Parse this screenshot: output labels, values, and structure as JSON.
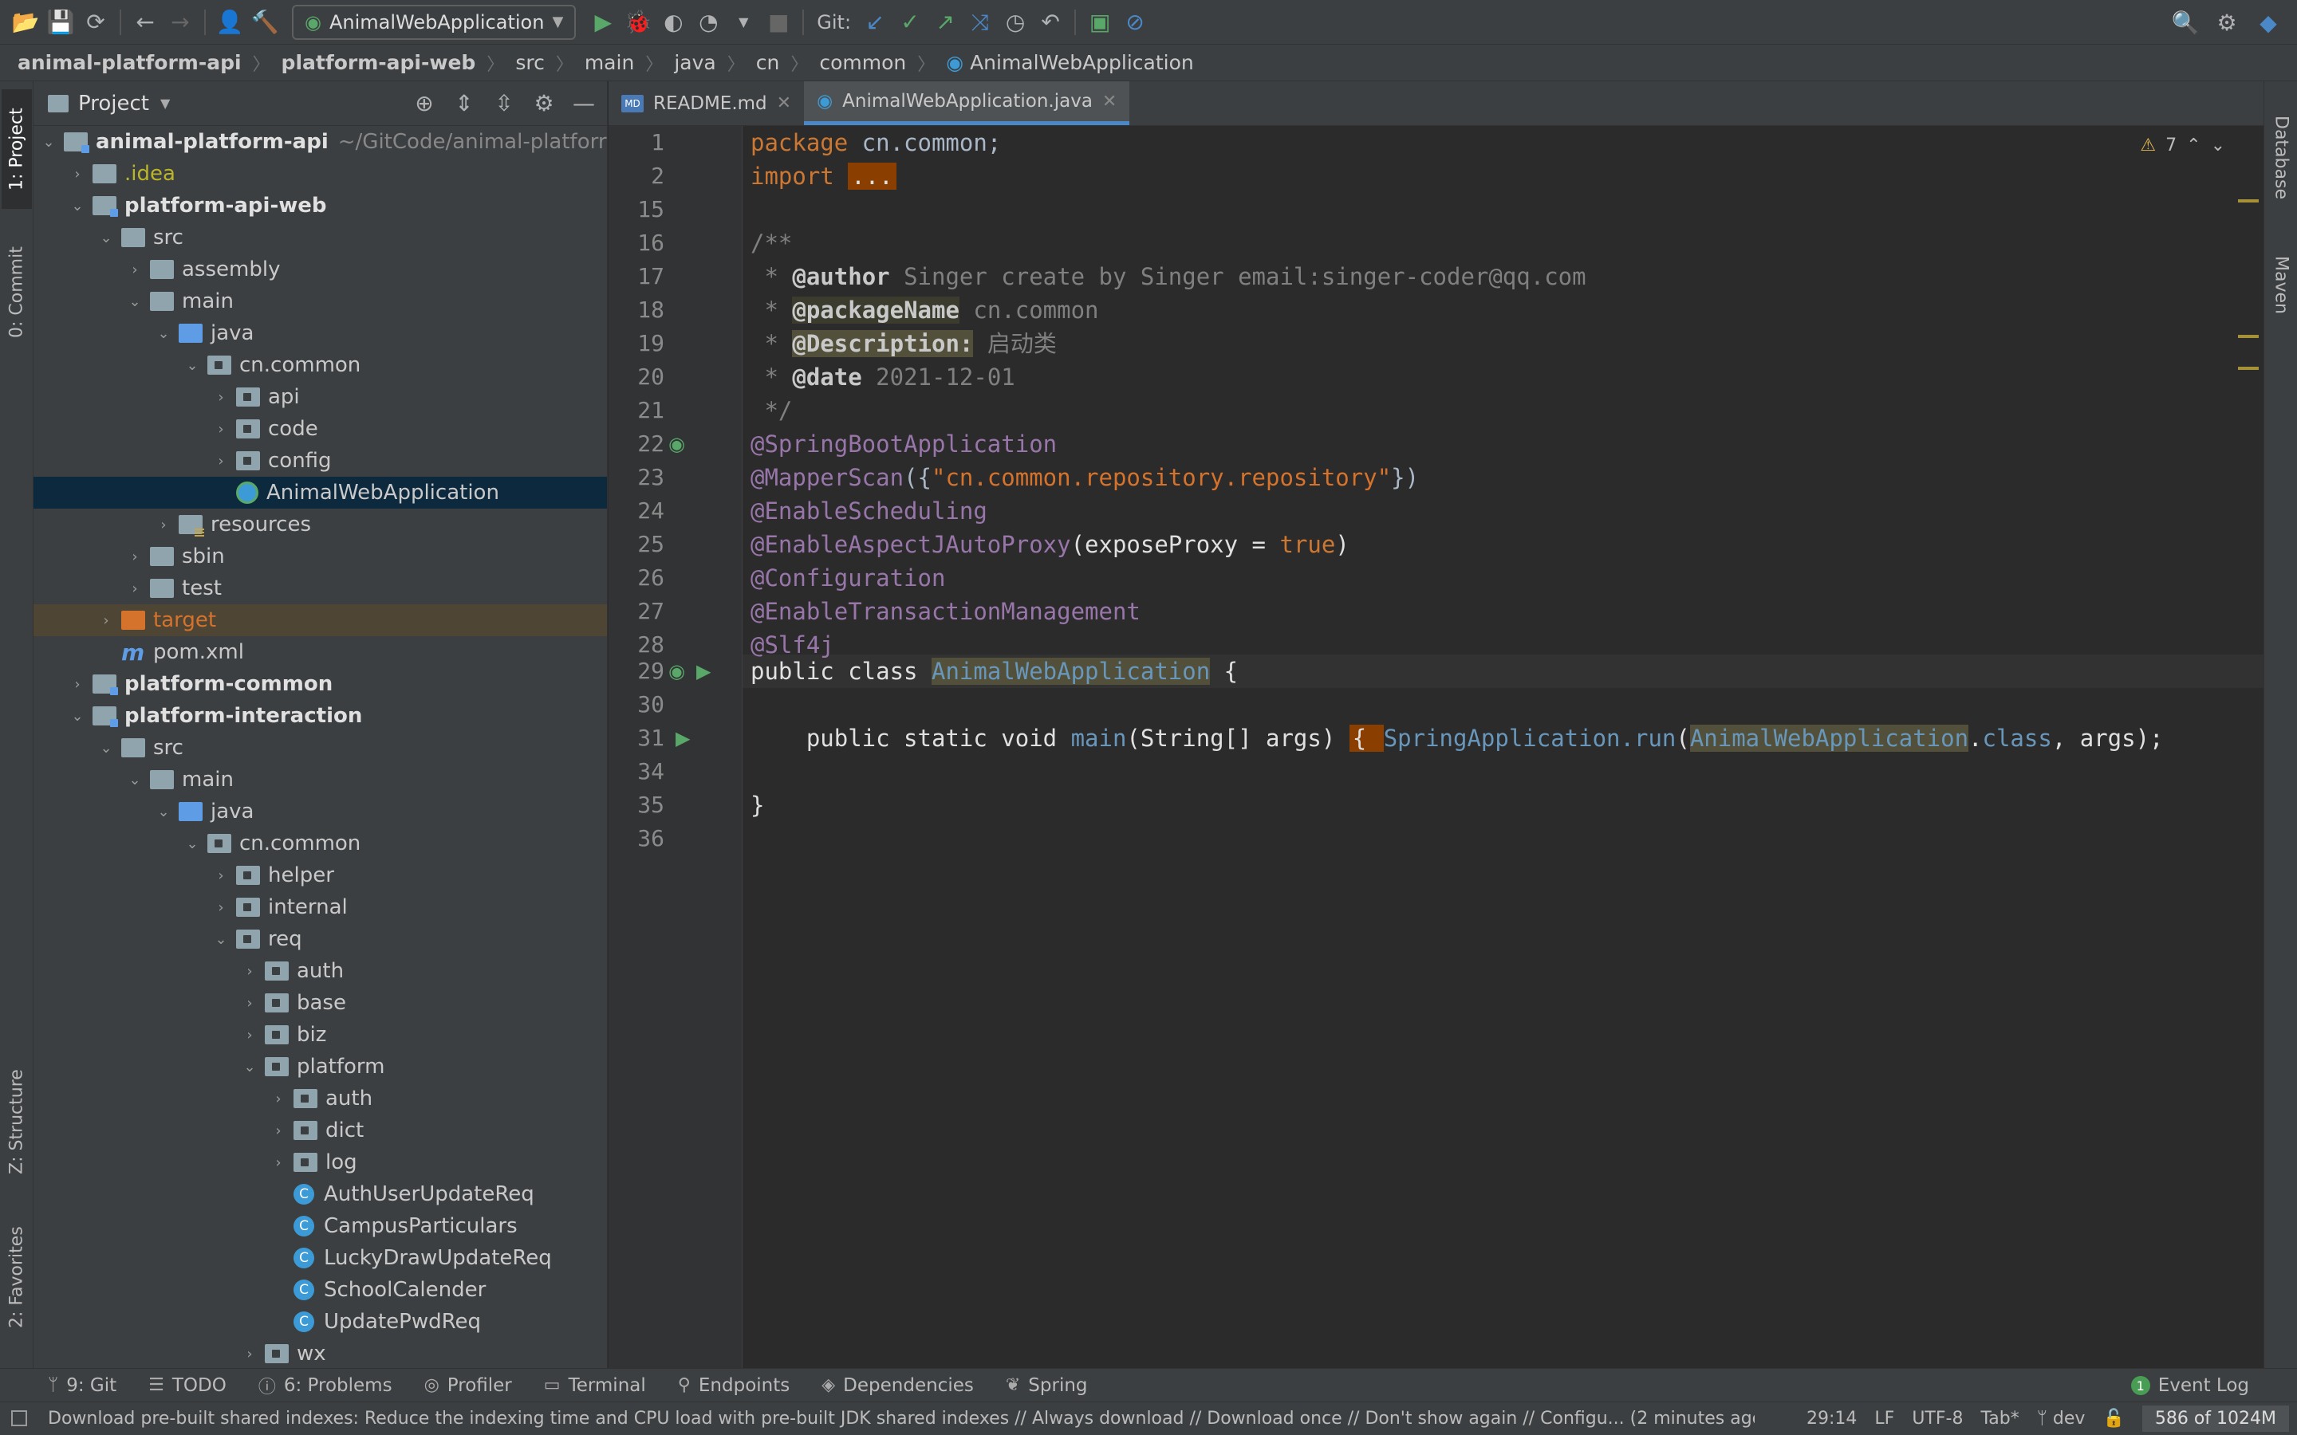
{
  "toolbar": {
    "run_config": "AnimalWebApplication",
    "git_label": "Git:"
  },
  "breadcrumb": [
    "animal-platform-api",
    "platform-api-web",
    "src",
    "main",
    "java",
    "cn",
    "common",
    "AnimalWebApplication"
  ],
  "left_stripe": {
    "project": "1: Project",
    "commit": "0: Commit",
    "structure": "Z: Structure",
    "favorites": "2: Favorites"
  },
  "right_stripe": {
    "database": "Database",
    "maven": "Maven"
  },
  "project_panel": {
    "title": "Project",
    "root_label": "animal-platform-api",
    "root_path": "~/GitCode/animal-platforr",
    "rows": [
      {
        "label": "animal-platform-api",
        "depth": 0,
        "icon": "module-folder",
        "expanded": true,
        "style": "bold"
      },
      {
        "label": ".idea",
        "depth": 1,
        "icon": "folder",
        "expanded": false,
        "style": "yellow"
      },
      {
        "label": "platform-api-web",
        "depth": 1,
        "icon": "module-folder",
        "expanded": true,
        "style": "bold"
      },
      {
        "label": "src",
        "depth": 2,
        "icon": "folder",
        "expanded": true,
        "style": ""
      },
      {
        "label": "assembly",
        "depth": 3,
        "icon": "folder",
        "expanded": false,
        "style": ""
      },
      {
        "label": "main",
        "depth": 3,
        "icon": "folder",
        "expanded": true,
        "style": ""
      },
      {
        "label": "java",
        "depth": 4,
        "icon": "source-folder",
        "expanded": true,
        "style": ""
      },
      {
        "label": "cn.common",
        "depth": 5,
        "icon": "package",
        "expanded": true,
        "style": ""
      },
      {
        "label": "api",
        "depth": 6,
        "icon": "package",
        "expanded": false,
        "style": ""
      },
      {
        "label": "code",
        "depth": 6,
        "icon": "package",
        "expanded": false,
        "style": ""
      },
      {
        "label": "config",
        "depth": 6,
        "icon": "package",
        "expanded": false,
        "style": ""
      },
      {
        "label": "AnimalWebApplication",
        "depth": 6,
        "icon": "spring-boot-class",
        "expanded": null,
        "style": "selected"
      },
      {
        "label": "resources",
        "depth": 4,
        "icon": "resources-folder",
        "expanded": false,
        "style": ""
      },
      {
        "label": "sbin",
        "depth": 3,
        "icon": "folder",
        "expanded": false,
        "style": ""
      },
      {
        "label": "test",
        "depth": 3,
        "icon": "folder",
        "expanded": false,
        "style": ""
      },
      {
        "label": "target",
        "depth": 2,
        "icon": "excluded-folder",
        "expanded": false,
        "style": "excluded"
      },
      {
        "label": "pom.xml",
        "depth": 2,
        "icon": "maven-file",
        "expanded": null,
        "style": ""
      },
      {
        "label": "platform-common",
        "depth": 1,
        "icon": "module-folder",
        "expanded": false,
        "style": "bold"
      },
      {
        "label": "platform-interaction",
        "depth": 1,
        "icon": "module-folder",
        "expanded": true,
        "style": "bold"
      },
      {
        "label": "src",
        "depth": 2,
        "icon": "folder",
        "expanded": true,
        "style": ""
      },
      {
        "label": "main",
        "depth": 3,
        "icon": "folder",
        "expanded": true,
        "style": ""
      },
      {
        "label": "java",
        "depth": 4,
        "icon": "source-folder",
        "expanded": true,
        "style": ""
      },
      {
        "label": "cn.common",
        "depth": 5,
        "icon": "package",
        "expanded": true,
        "style": ""
      },
      {
        "label": "helper",
        "depth": 6,
        "icon": "package",
        "expanded": false,
        "style": ""
      },
      {
        "label": "internal",
        "depth": 6,
        "icon": "package",
        "expanded": false,
        "style": ""
      },
      {
        "label": "req",
        "depth": 6,
        "icon": "package",
        "expanded": true,
        "style": ""
      },
      {
        "label": "auth",
        "depth": 7,
        "icon": "package",
        "expanded": false,
        "style": ""
      },
      {
        "label": "base",
        "depth": 7,
        "icon": "package",
        "expanded": false,
        "style": ""
      },
      {
        "label": "biz",
        "depth": 7,
        "icon": "package",
        "expanded": false,
        "style": ""
      },
      {
        "label": "platform",
        "depth": 7,
        "icon": "package",
        "expanded": true,
        "style": ""
      },
      {
        "label": "auth",
        "depth": 8,
        "icon": "package",
        "expanded": false,
        "style": ""
      },
      {
        "label": "dict",
        "depth": 8,
        "icon": "package",
        "expanded": false,
        "style": ""
      },
      {
        "label": "log",
        "depth": 8,
        "icon": "package",
        "expanded": false,
        "style": ""
      },
      {
        "label": "AuthUserUpdateReq",
        "depth": 8,
        "icon": "class",
        "expanded": null,
        "style": ""
      },
      {
        "label": "CampusParticulars",
        "depth": 8,
        "icon": "class",
        "expanded": null,
        "style": ""
      },
      {
        "label": "LuckyDrawUpdateReq",
        "depth": 8,
        "icon": "class",
        "expanded": null,
        "style": ""
      },
      {
        "label": "SchoolCalender",
        "depth": 8,
        "icon": "class",
        "expanded": null,
        "style": ""
      },
      {
        "label": "UpdatePwdReq",
        "depth": 8,
        "icon": "class",
        "expanded": null,
        "style": ""
      },
      {
        "label": "wx",
        "depth": 7,
        "icon": "package",
        "expanded": false,
        "style": ""
      }
    ]
  },
  "tabs": [
    {
      "label": "README.md",
      "active": false
    },
    {
      "label": "AnimalWebApplication.java",
      "active": true
    }
  ],
  "editor": {
    "warnings": "7",
    "line_numbers": [
      "1",
      "2",
      "15",
      "16",
      "17",
      "18",
      "19",
      "20",
      "21",
      "22",
      "23",
      "24",
      "25",
      "26",
      "27",
      "28",
      "29",
      "30",
      "31",
      "34",
      "35",
      "36"
    ],
    "code": {
      "l1_kw": "package",
      "l1_rest": " cn.common;",
      "l2_kw": "import",
      "l2_fold": "...",
      "l16": "/**",
      "l17_pre": " * ",
      "l17_tag": "@author",
      "l17_rest": " Singer create by Singer email:singer-coder@qq.com",
      "l18_pre": " * ",
      "l18_tag": "@packageName",
      "l18_rest": " cn.common",
      "l19_pre": " * ",
      "l19_tag": "@Description:",
      "l19_rest": " 启动类",
      "l20_pre": " * ",
      "l20_tag": "@date",
      "l20_rest": " 2021-12-01",
      "l21": " */",
      "l22": "@SpringBootApplication",
      "l23_ann": "@MapperScan",
      "l23_a": "({",
      "l23_str": "\"cn.common.repository.repository\"",
      "l23_b": "})",
      "l24": "@EnableScheduling",
      "l25_ann": "@EnableAspectJAutoProxy",
      "l25_a": "(exposeProxy = ",
      "l25_kw": "true",
      "l25_b": ")",
      "l26": "@Configuration",
      "l27": "@EnableTransactionManagement",
      "l28": "@Slf4j",
      "l29_kw": "public class ",
      "l29_cls": "AnimalWebApplication",
      "l29_b": " {",
      "l31_kw": "    public static void ",
      "l31_m": "main",
      "l31_a": "(String[] args) ",
      "l31_fold": "{ ",
      "l31_b": "SpringApplication.",
      "l31_run": "run",
      "l31_c": "(",
      "l31_cls": "AnimalWebApplication",
      "l31_d": ".",
      "l31_kw2": "class",
      "l31_e": ", args);",
      "l35": "}"
    }
  },
  "bottom_tools": [
    "9: Git",
    "TODO",
    "6: Problems",
    "Profiler",
    "Terminal",
    "Endpoints",
    "Dependencies",
    "Spring"
  ],
  "event_log": {
    "count": "1",
    "label": "Event Log"
  },
  "status": {
    "message": "Download pre-built shared indexes: Reduce the indexing time and CPU load with pre-built JDK shared indexes // Always download // Download once // Don't show again // Configu... (2 minutes agc",
    "position": "29:14",
    "line_sep": "LF",
    "encoding": "UTF-8",
    "indent": "Tab*",
    "branch": "dev",
    "memory": "586 of 1024M"
  }
}
